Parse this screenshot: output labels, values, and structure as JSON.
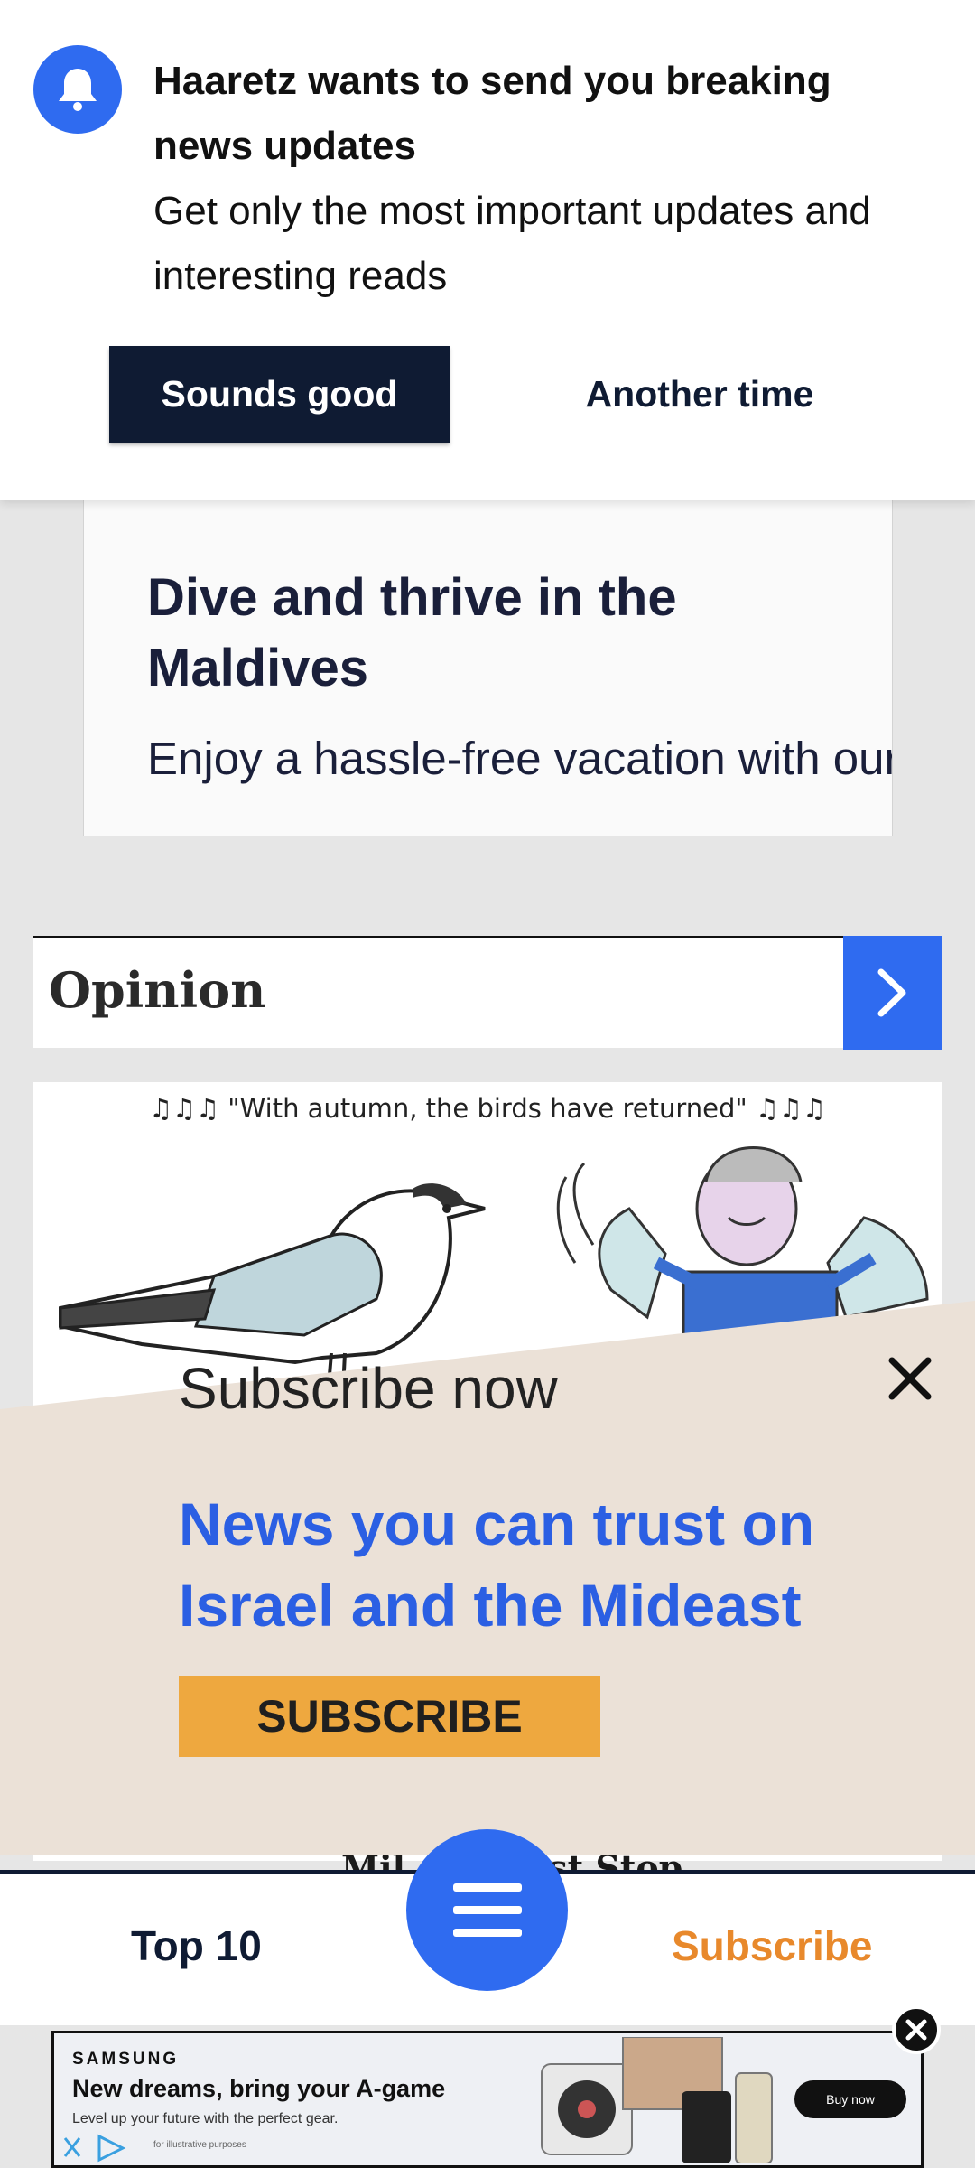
{
  "notification": {
    "title": "Haaretz wants to send you breaking news updates",
    "body": "Get only the most important updates and interesting reads",
    "accept_label": "Sounds good",
    "decline_label": "Another time",
    "icon": "bell-icon",
    "accent_color": "#2f6bf0"
  },
  "ad_card": {
    "title": "Dive and thrive in the Maldives",
    "subtitle": "Enjoy a hassle-free vacation with our All-Inclu..."
  },
  "section": {
    "title": "Opinion",
    "arrow_icon": "chevron-right-icon"
  },
  "cartoon": {
    "caption": "♫♫♫ \"With autumn, the birds have returned\" ♫♫♫"
  },
  "behind_headline": "Mil… e Must Stop",
  "subscribe_overlay": {
    "heading": "Subscribe now",
    "tagline": "News you can trust on Israel and the Mideast",
    "button_label": "SUBSCRIBE",
    "close_icon": "close-icon",
    "background_color": "#ebe1d7",
    "button_color": "#eea83f"
  },
  "bottom_nav": {
    "left_label": "Top 10",
    "right_label": "Subscribe",
    "menu_icon": "hamburger-menu-icon"
  },
  "banner_ad": {
    "brand": "SAMSUNG",
    "headline": "New dreams, bring your A-game",
    "subline": "Level up your future with the perfect gear.",
    "fine_print": "for illustrative purposes",
    "cta": "Buy now"
  }
}
